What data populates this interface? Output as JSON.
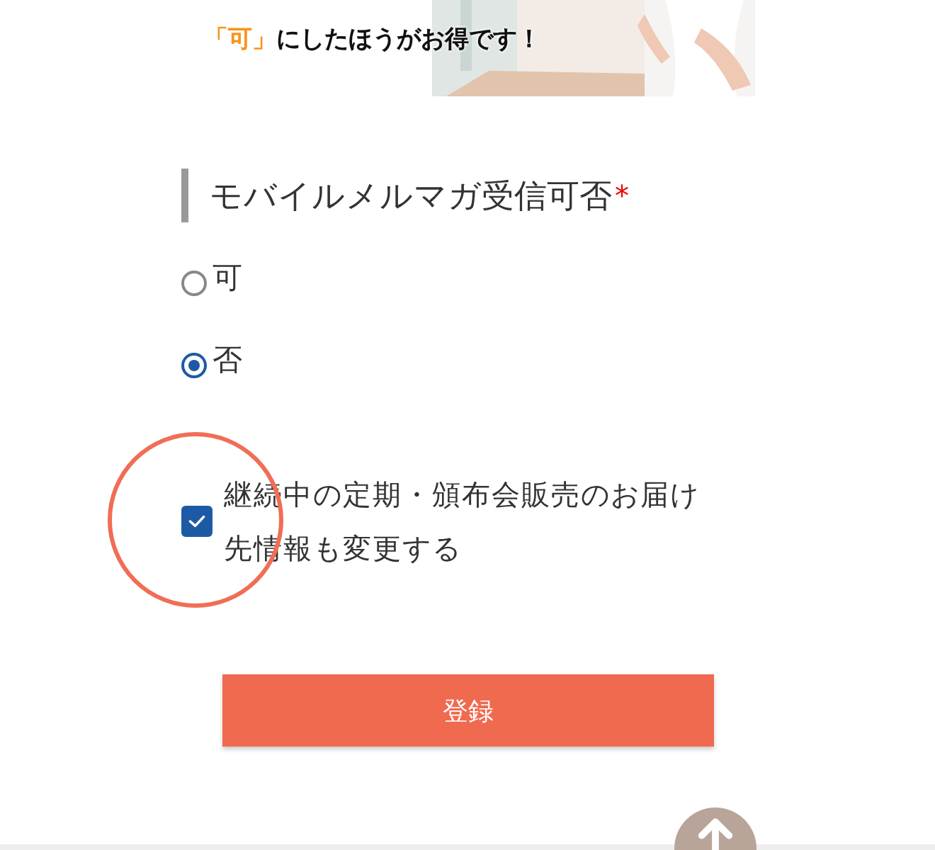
{
  "banner": {
    "highlight": "「可」",
    "text": "にしたほうがお得です！"
  },
  "field": {
    "label": "モバイルメルマガ受信可否",
    "required_mark": "*",
    "options": [
      {
        "label": "可",
        "selected": false
      },
      {
        "label": "否",
        "selected": true
      }
    ]
  },
  "checkbox": {
    "label": "継続中の定期・頒布会販売のお届け先情報も変更する",
    "checked": true
  },
  "submit_button": "登録"
}
